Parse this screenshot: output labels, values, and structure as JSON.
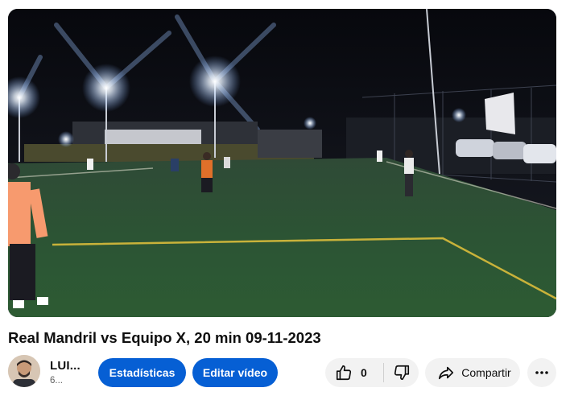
{
  "video": {
    "title": "Real Mandril vs Equipo X, 20 min 09-11-2023"
  },
  "channel": {
    "name": "LUI...",
    "subscribers": "6..."
  },
  "actions": {
    "stats_label": "Estadísticas",
    "edit_label": "Editar vídeo",
    "like_count": "0",
    "share_label": "Compartir"
  },
  "icons": {
    "like": "thumbs-up-icon",
    "dislike": "thumbs-down-icon",
    "share": "share-arrow-icon",
    "more": "more-horizontal-icon"
  },
  "colors": {
    "primary_button": "#065fd4",
    "secondary_button": "#f2f2f2",
    "text": "#0f0f0f",
    "muted_text": "#606060"
  }
}
